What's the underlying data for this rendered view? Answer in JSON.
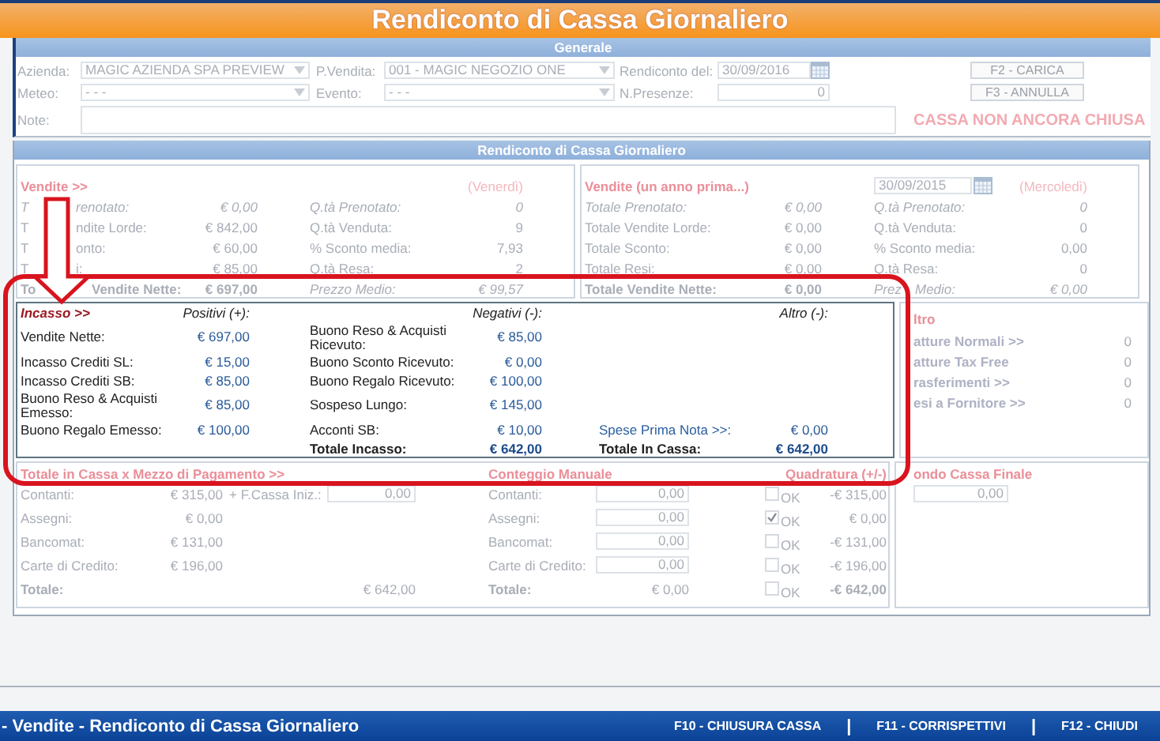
{
  "title": "Rendiconto di Cassa Giornaliero",
  "generale": {
    "title": "Generale",
    "azienda": {
      "label": "Azienda:",
      "value": "MAGIC AZIENDA SPA PREVIEW"
    },
    "punto_vendita": {
      "label": "P.Vendita:",
      "value": "001 - MAGIC NEGOZIO ONE"
    },
    "rendiconto_del": {
      "label": "Rendiconto del:",
      "value": "30/09/2016"
    },
    "meteo": {
      "label": "Meteo:",
      "value": "- - -"
    },
    "evento": {
      "label": "Evento:",
      "value": "- - -"
    },
    "presenze": {
      "label": "N.Presenze:",
      "value": "0"
    },
    "note": {
      "label": "Note:"
    },
    "buttons": [
      "F2 - CARICA",
      "F3 - ANNULLA"
    ],
    "status": "CASSA NON ANCORA CHIUSA"
  },
  "rendiconto": {
    "title": "Rendiconto di Cassa Giornaliero",
    "vendite": [
      {
        "title": "Vendite >>",
        "day": "(Venerdì)",
        "rows": [
          {
            "kind": "reserved",
            "label_parts": [
              "T",
              "renotato:"
            ],
            "value": "€ 0,00",
            "qty_label": "Q.tà Prenotato:",
            "qty_value": "0"
          },
          {
            "kind": "normal",
            "label_parts": [
              "T",
              "ndite Lorde:"
            ],
            "value": "€ 842,00",
            "qty_label": "Q.tà Venduta:",
            "qty_value": "9"
          },
          {
            "kind": "normal",
            "label_parts": [
              "T",
              "onto:"
            ],
            "value": "€ 60,00",
            "qty_label": "% Sconto media:",
            "qty_value": "7,93"
          },
          {
            "kind": "normal",
            "label_parts": [
              "T",
              "i:"
            ],
            "value": "€ 85,00",
            "qty_label": "Q.tà Resa:",
            "qty_value": "2"
          },
          {
            "kind": "total",
            "label_parts": [
              "To",
              "Vendite Nette:"
            ],
            "value": "€ 697,00",
            "qty_label": "Prezzo Medio:",
            "qty_value": "€ 99,57"
          }
        ]
      },
      {
        "title": "Vendite (un anno prima...)",
        "date": "30/09/2015",
        "day": "(Mercoledì)",
        "rows": [
          {
            "kind": "reserved",
            "label": "Totale Prenotato:",
            "value": "€ 0,00",
            "qty_label": "Q.tà Prenotato:",
            "qty_value": "0"
          },
          {
            "kind": "normal",
            "label": "Totale Vendite Lorde:",
            "value": "€ 0,00",
            "qty_label": "Q.tà Venduta:",
            "qty_value": "0"
          },
          {
            "kind": "normal",
            "label": "Totale Sconto:",
            "value": "€ 0,00",
            "qty_label": "% Sconto media:",
            "qty_value": "0,00"
          },
          {
            "kind": "normal",
            "label": "Totale Resi:",
            "value": "€ 0,00",
            "qty_label": "Q.tà Resa:",
            "qty_value": "0"
          },
          {
            "kind": "total",
            "label": "Totale Vendite Nette:",
            "value": "€ 0,00",
            "qty_label_parts": [
              "Prez",
              "Medio:"
            ],
            "qty_value": "€ 0,00"
          }
        ]
      }
    ],
    "incasso": {
      "title": "Incasso >>",
      "headers": [
        "Positivi (+):",
        "Negativi (-):",
        "Altro (-):"
      ],
      "rows": [
        {
          "kind": "item",
          "positive": {
            "label": "Vendite Nette:",
            "value": "€ 697,00"
          },
          "negative": {
            "label": "Buono Reso & Acquisti Ricevuto:",
            "value": "€ 85,00"
          }
        },
        {
          "kind": "item",
          "positive": {
            "label": "Incasso Crediti SL:",
            "value": "€ 15,00"
          },
          "negative": {
            "label": "Buono Sconto Ricevuto:",
            "value": "€ 0,00"
          }
        },
        {
          "kind": "item",
          "positive": {
            "label": "Incasso Crediti SB:",
            "value": "€ 85,00"
          },
          "negative": {
            "label": "Buono Regalo Ricevuto:",
            "value": "€ 100,00"
          }
        },
        {
          "kind": "item",
          "positive": {
            "label": "Buono Reso & Acquisti Emesso:",
            "value": "€ 85,00"
          },
          "negative": {
            "label": "Sospeso Lungo:",
            "value": "€ 145,00"
          }
        },
        {
          "kind": "item",
          "positive": {
            "label": "Buono Regalo Emesso:",
            "value": "€ 100,00"
          },
          "negative": {
            "label": "Acconti SB:",
            "value": "€ 10,00"
          },
          "other": {
            "label": "Spese Prima Nota >>:",
            "value": "€ 0,00"
          }
        },
        {
          "kind": "total",
          "negative": {
            "label": "Totale Incasso:",
            "value": "€ 642,00"
          },
          "other": {
            "label": "Totale In Cassa:",
            "value": "€ 642,00"
          }
        }
      ]
    },
    "altro": {
      "title": "ltro",
      "items": [
        {
          "label": "atture Normali >>",
          "value": "0"
        },
        {
          "label": "atture Tax Free",
          "value": "0"
        },
        {
          "label": "rasferimenti >>",
          "value": "0"
        },
        {
          "label": "esi a Fornitore >>",
          "value": "0"
        }
      ]
    },
    "totali": {
      "title": "Totale in Cassa x Mezzo di Pagamento >>",
      "manual_title": "Conteggio Manuale",
      "balance_title": "Quadratura (+/-)",
      "rows": [
        {
          "kind": "payment",
          "label": "Contanti:",
          "value": "€ 315,00",
          "extra_label": "+ F.Cassa Iniz.:",
          "extra_value": "0,00",
          "manual_label": "Contanti:",
          "manual_value": "0,00",
          "checked": false,
          "ok": "OK",
          "difference": "-€ 315,00"
        },
        {
          "kind": "payment",
          "label": "Assegni:",
          "value": "€ 0,00",
          "manual_label": "Assegni:",
          "manual_value": "0,00",
          "checked": true,
          "ok": "OK",
          "difference": "€ 0,00"
        },
        {
          "kind": "payment",
          "label": "Bancomat:",
          "value": "€ 131,00",
          "manual_label": "Bancomat:",
          "manual_value": "0,00",
          "checked": false,
          "ok": "OK",
          "difference": "-€ 131,00"
        },
        {
          "kind": "payment",
          "label": "Carte di Credito:",
          "value": "€ 196,00",
          "manual_label": "Carte di Credito:",
          "manual_value": "0,00",
          "checked": false,
          "ok": "OK",
          "difference": "-€ 196,00"
        },
        {
          "kind": "total",
          "label": "Totale:",
          "value": "€ 642,00",
          "manual_label": "Totale:",
          "manual_value": "€ 0,00",
          "checked": false,
          "ok": "OK",
          "difference": "-€ 642,00"
        }
      ]
    },
    "fondo": {
      "title": "ondo Cassa Finale",
      "value": "0,00"
    }
  },
  "footer": {
    "title": "- Vendite - Rendiconto di Cassa Giornaliero",
    "actions": [
      {
        "kind": "action",
        "label": "F10 - CHIUSURA CASSA"
      },
      {
        "kind": "separator",
        "label": "|"
      },
      {
        "kind": "action",
        "label": "F11 - CORRISPETTIVI"
      },
      {
        "kind": "separator",
        "label": "|"
      },
      {
        "kind": "action",
        "label": "F12 - CHIUDI"
      }
    ]
  }
}
